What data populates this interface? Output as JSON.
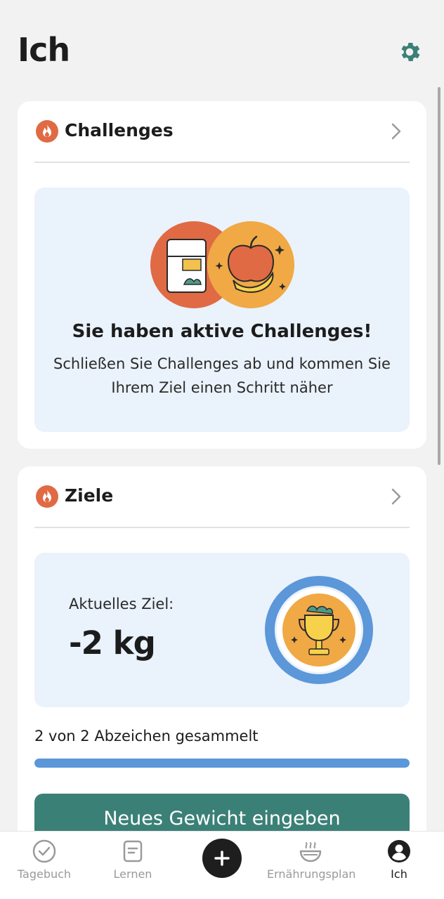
{
  "header": {
    "title": "Ich",
    "settings_icon": "gear-icon"
  },
  "colors": {
    "accent": "#3b8077",
    "flame": "#e06a44",
    "progress": "#5b97d9",
    "box_bg": "#eaf2fb"
  },
  "challenges": {
    "title": "Challenges",
    "heading": "Sie haben aktive Challenges!",
    "text": "Schließen Sie Challenges ab und kommen Sie Ihrem Ziel einen Schritt näher"
  },
  "goals": {
    "title": "Ziele",
    "current_label": "Aktuelles Ziel:",
    "current_value": "-2 kg",
    "badges_text": "2 von 2 Abzeichen gesammelt",
    "badges_progress": 1.0,
    "button_label": "Neues Gewicht eingeben"
  },
  "tabbar": {
    "items": [
      {
        "label": "Tagebuch",
        "icon": "check-circle-icon"
      },
      {
        "label": "Lernen",
        "icon": "document-icon"
      },
      {
        "label": "",
        "icon": "plus-icon"
      },
      {
        "label": "Ernährungsplan",
        "icon": "bowl-icon"
      },
      {
        "label": "Ich",
        "icon": "profile-icon",
        "active": true
      }
    ]
  }
}
